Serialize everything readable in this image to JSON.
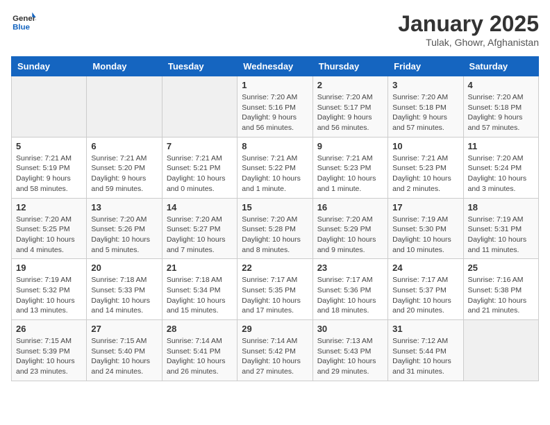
{
  "header": {
    "logo_line1": "General",
    "logo_line2": "Blue",
    "title": "January 2025",
    "subtitle": "Tulak, Ghowr, Afghanistan"
  },
  "weekdays": [
    "Sunday",
    "Monday",
    "Tuesday",
    "Wednesday",
    "Thursday",
    "Friday",
    "Saturday"
  ],
  "weeks": [
    [
      {
        "day": "",
        "sunrise": "",
        "sunset": "",
        "daylight": ""
      },
      {
        "day": "",
        "sunrise": "",
        "sunset": "",
        "daylight": ""
      },
      {
        "day": "",
        "sunrise": "",
        "sunset": "",
        "daylight": ""
      },
      {
        "day": "1",
        "sunrise": "Sunrise: 7:20 AM",
        "sunset": "Sunset: 5:16 PM",
        "daylight": "Daylight: 9 hours and 56 minutes."
      },
      {
        "day": "2",
        "sunrise": "Sunrise: 7:20 AM",
        "sunset": "Sunset: 5:17 PM",
        "daylight": "Daylight: 9 hours and 56 minutes."
      },
      {
        "day": "3",
        "sunrise": "Sunrise: 7:20 AM",
        "sunset": "Sunset: 5:18 PM",
        "daylight": "Daylight: 9 hours and 57 minutes."
      },
      {
        "day": "4",
        "sunrise": "Sunrise: 7:20 AM",
        "sunset": "Sunset: 5:18 PM",
        "daylight": "Daylight: 9 hours and 57 minutes."
      }
    ],
    [
      {
        "day": "5",
        "sunrise": "Sunrise: 7:21 AM",
        "sunset": "Sunset: 5:19 PM",
        "daylight": "Daylight: 9 hours and 58 minutes."
      },
      {
        "day": "6",
        "sunrise": "Sunrise: 7:21 AM",
        "sunset": "Sunset: 5:20 PM",
        "daylight": "Daylight: 9 hours and 59 minutes."
      },
      {
        "day": "7",
        "sunrise": "Sunrise: 7:21 AM",
        "sunset": "Sunset: 5:21 PM",
        "daylight": "Daylight: 10 hours and 0 minutes."
      },
      {
        "day": "8",
        "sunrise": "Sunrise: 7:21 AM",
        "sunset": "Sunset: 5:22 PM",
        "daylight": "Daylight: 10 hours and 1 minute."
      },
      {
        "day": "9",
        "sunrise": "Sunrise: 7:21 AM",
        "sunset": "Sunset: 5:23 PM",
        "daylight": "Daylight: 10 hours and 1 minute."
      },
      {
        "day": "10",
        "sunrise": "Sunrise: 7:21 AM",
        "sunset": "Sunset: 5:23 PM",
        "daylight": "Daylight: 10 hours and 2 minutes."
      },
      {
        "day": "11",
        "sunrise": "Sunrise: 7:20 AM",
        "sunset": "Sunset: 5:24 PM",
        "daylight": "Daylight: 10 hours and 3 minutes."
      }
    ],
    [
      {
        "day": "12",
        "sunrise": "Sunrise: 7:20 AM",
        "sunset": "Sunset: 5:25 PM",
        "daylight": "Daylight: 10 hours and 4 minutes."
      },
      {
        "day": "13",
        "sunrise": "Sunrise: 7:20 AM",
        "sunset": "Sunset: 5:26 PM",
        "daylight": "Daylight: 10 hours and 5 minutes."
      },
      {
        "day": "14",
        "sunrise": "Sunrise: 7:20 AM",
        "sunset": "Sunset: 5:27 PM",
        "daylight": "Daylight: 10 hours and 7 minutes."
      },
      {
        "day": "15",
        "sunrise": "Sunrise: 7:20 AM",
        "sunset": "Sunset: 5:28 PM",
        "daylight": "Daylight: 10 hours and 8 minutes."
      },
      {
        "day": "16",
        "sunrise": "Sunrise: 7:20 AM",
        "sunset": "Sunset: 5:29 PM",
        "daylight": "Daylight: 10 hours and 9 minutes."
      },
      {
        "day": "17",
        "sunrise": "Sunrise: 7:19 AM",
        "sunset": "Sunset: 5:30 PM",
        "daylight": "Daylight: 10 hours and 10 minutes."
      },
      {
        "day": "18",
        "sunrise": "Sunrise: 7:19 AM",
        "sunset": "Sunset: 5:31 PM",
        "daylight": "Daylight: 10 hours and 11 minutes."
      }
    ],
    [
      {
        "day": "19",
        "sunrise": "Sunrise: 7:19 AM",
        "sunset": "Sunset: 5:32 PM",
        "daylight": "Daylight: 10 hours and 13 minutes."
      },
      {
        "day": "20",
        "sunrise": "Sunrise: 7:18 AM",
        "sunset": "Sunset: 5:33 PM",
        "daylight": "Daylight: 10 hours and 14 minutes."
      },
      {
        "day": "21",
        "sunrise": "Sunrise: 7:18 AM",
        "sunset": "Sunset: 5:34 PM",
        "daylight": "Daylight: 10 hours and 15 minutes."
      },
      {
        "day": "22",
        "sunrise": "Sunrise: 7:17 AM",
        "sunset": "Sunset: 5:35 PM",
        "daylight": "Daylight: 10 hours and 17 minutes."
      },
      {
        "day": "23",
        "sunrise": "Sunrise: 7:17 AM",
        "sunset": "Sunset: 5:36 PM",
        "daylight": "Daylight: 10 hours and 18 minutes."
      },
      {
        "day": "24",
        "sunrise": "Sunrise: 7:17 AM",
        "sunset": "Sunset: 5:37 PM",
        "daylight": "Daylight: 10 hours and 20 minutes."
      },
      {
        "day": "25",
        "sunrise": "Sunrise: 7:16 AM",
        "sunset": "Sunset: 5:38 PM",
        "daylight": "Daylight: 10 hours and 21 minutes."
      }
    ],
    [
      {
        "day": "26",
        "sunrise": "Sunrise: 7:15 AM",
        "sunset": "Sunset: 5:39 PM",
        "daylight": "Daylight: 10 hours and 23 minutes."
      },
      {
        "day": "27",
        "sunrise": "Sunrise: 7:15 AM",
        "sunset": "Sunset: 5:40 PM",
        "daylight": "Daylight: 10 hours and 24 minutes."
      },
      {
        "day": "28",
        "sunrise": "Sunrise: 7:14 AM",
        "sunset": "Sunset: 5:41 PM",
        "daylight": "Daylight: 10 hours and 26 minutes."
      },
      {
        "day": "29",
        "sunrise": "Sunrise: 7:14 AM",
        "sunset": "Sunset: 5:42 PM",
        "daylight": "Daylight: 10 hours and 27 minutes."
      },
      {
        "day": "30",
        "sunrise": "Sunrise: 7:13 AM",
        "sunset": "Sunset: 5:43 PM",
        "daylight": "Daylight: 10 hours and 29 minutes."
      },
      {
        "day": "31",
        "sunrise": "Sunrise: 7:12 AM",
        "sunset": "Sunset: 5:44 PM",
        "daylight": "Daylight: 10 hours and 31 minutes."
      },
      {
        "day": "",
        "sunrise": "",
        "sunset": "",
        "daylight": ""
      }
    ]
  ]
}
